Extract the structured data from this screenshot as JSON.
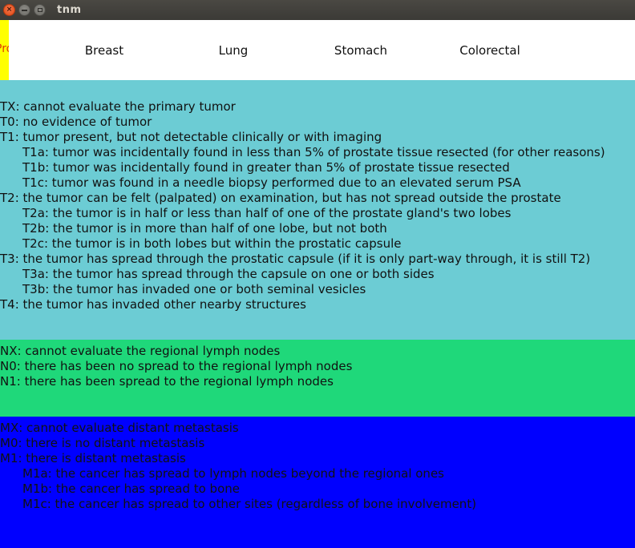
{
  "window": {
    "title": "tnm",
    "close_glyph": "×"
  },
  "tabs": {
    "selected_label": "Prostate",
    "items": [
      "Breast",
      "Lung",
      "Stomach",
      "Colorectal"
    ]
  },
  "t_stage": [
    "TX: cannot evaluate the primary tumor",
    "T0: no evidence of tumor",
    "T1: tumor present, but not detectable clinically or with imaging",
    "T1a: tumor was incidentally found in less than 5% of prostate tissue resected (for other reasons)",
    "T1b: tumor was incidentally found in greater than 5% of prostate tissue resected",
    "T1c: tumor was found in a needle biopsy performed due to an elevated serum PSA",
    "T2: the tumor can be felt (palpated) on examination, but has not spread outside the prostate",
    "T2a: the tumor is in half or less than half of one of the prostate gland's two lobes",
    "T2b: the tumor is in more than half of one lobe, but not both",
    "T2c: the tumor is in both lobes but within the prostatic capsule",
    "T3: the tumor has spread through the prostatic capsule (if it is only part-way through, it is still T2)",
    "T3a: the tumor has spread through the capsule on one or both sides",
    "T3b: the tumor has invaded one or both seminal vesicles",
    "T4: the tumor has invaded other nearby structures"
  ],
  "n_stage": [
    "NX: cannot evaluate the regional lymph nodes",
    "N0: there has been no spread to the regional lymph nodes",
    "N1: there has been spread to the regional lymph nodes"
  ],
  "m_stage": [
    "MX: cannot evaluate distant metastasis",
    "M0: there is no distant metastasis",
    "M1: there is distant metastasis",
    "M1a: the cancer has spread to lymph nodes beyond the regional ones",
    "M1b: the cancer has spread to bone",
    "M1c: the cancer has spread to other sites (regardless of bone involvement)"
  ],
  "colors": {
    "selected_tab": "#ffff00",
    "t_section": "#6cccd4",
    "n_section": "#1fd87a",
    "m_section": "#0000ff"
  }
}
